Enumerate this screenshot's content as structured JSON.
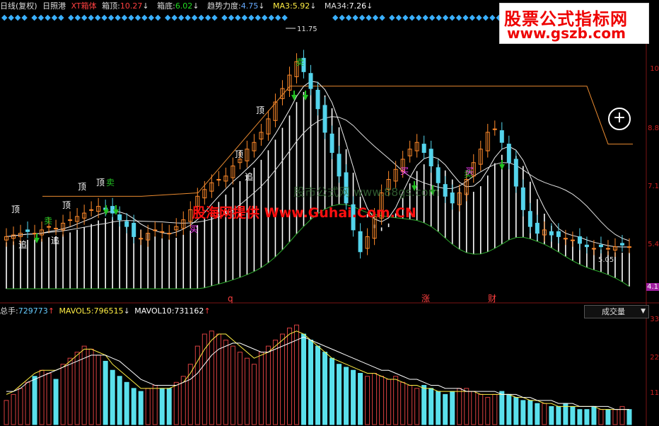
{
  "header": {
    "period": "日线(复权)",
    "stock": "日照港",
    "indicator": "XT箱体",
    "box_top_label": "箱顶:",
    "box_top_value": "10.27",
    "box_top_arrow": "↓",
    "box_bottom_label": "箱底:",
    "box_bottom_value": "6.02",
    "box_bottom_arrow": "↓",
    "trend_label": "趋势力度:",
    "trend_value": "4.75",
    "trend_arrow": "↓",
    "ma3_label": "MA3:",
    "ma3_value": "5.92",
    "ma3_arrow": "↓",
    "ma34_label": "MA34:",
    "ma34_value": "7.26",
    "ma34_arrow": "↓"
  },
  "volume_header": {
    "total_label": "总手:",
    "total_value": "729773",
    "total_arrow": "↑",
    "mavol5_label": "MAVOL5:",
    "mavol5_value": "796515",
    "mavol5_arrow": "↓",
    "mavol10_label": "MAVOL10:",
    "mavol10_value": "731162",
    "mavol10_arrow": "↑"
  },
  "selector": {
    "value": "成交量",
    "arrow": "▼"
  },
  "watermark": {
    "title": "股票公式指标网",
    "url": "www.gszb.com"
  },
  "center_watermark": "股海网提供 Www.Guhai.Com.CN",
  "faint_watermark": "股市公式网  www.88gs.com",
  "plus_icon": "+",
  "colors": {
    "up": "#ff8a2a",
    "down": "#54d4ec",
    "sell_signal": "#22c022",
    "buy_signal": "#ff40ff",
    "box_line": "#e98a30",
    "ma_line": "#e0e0e0",
    "axis_text": "#d02020",
    "vol_up": "#d84040",
    "vol_down": "#5ae0ec"
  },
  "chart_data": [
    {
      "type": "candlestick",
      "price_axis_labels": [
        "10",
        "8.8",
        "7.1",
        "5.4",
        "4.1"
      ],
      "high_marker": "11.75",
      "low_marker": "5.05",
      "annotations": {
        "top_labels": [
          "顶",
          "顶",
          "顶",
          "顶",
          "顶",
          "顶"
        ],
        "sell_labels": [
          "卖",
          "卖",
          "卖",
          "卖"
        ],
        "buy_labels": [
          "买",
          "买",
          "买"
        ],
        "chase_labels": [
          "追",
          "追",
          "追"
        ],
        "event_labels": [
          "q",
          "涨",
          "财"
        ]
      },
      "box_line_values": [
        7.0,
        7.0,
        7.1,
        10.27,
        10.27,
        8.55,
        8.55
      ],
      "closes": [
        5.8,
        5.85,
        5.9,
        5.95,
        5.9,
        6.0,
        6.1,
        6.05,
        6.2,
        6.3,
        6.4,
        6.5,
        6.6,
        6.7,
        6.6,
        6.5,
        6.3,
        6.1,
        5.8,
        5.75,
        5.9,
        6.0,
        5.95,
        5.9,
        6.1,
        6.3,
        6.6,
        7.0,
        7.2,
        7.4,
        7.5,
        7.6,
        7.9,
        8.1,
        8.4,
        8.6,
        8.9,
        9.3,
        9.8,
        10.2,
        10.6,
        11.0,
        10.7,
        10.2,
        9.6,
        8.9,
        8.3,
        7.6,
        6.8,
        6.0,
        5.35,
        5.8,
        6.4,
        7.1,
        7.5,
        7.8,
        8.1,
        8.4,
        8.6,
        8.3,
        7.9,
        7.4,
        7.0,
        6.8,
        7.1,
        7.5,
        8.0,
        8.4,
        8.9,
        9.0,
        8.6,
        8.0,
        7.3,
        6.6,
        6.1,
        5.9,
        6.0,
        5.85,
        5.8,
        5.75,
        5.7,
        5.6,
        5.5,
        5.45,
        5.5,
        5.45,
        5.5,
        5.55,
        5.5
      ]
    },
    {
      "type": "bar",
      "name_label": "成交量",
      "y_axis_labels": [
        "33",
        "22",
        "11"
      ],
      "values": [
        8,
        10,
        12,
        14,
        16,
        18,
        17,
        15,
        20,
        22,
        24,
        26,
        25,
        23,
        21,
        18,
        16,
        14,
        12,
        11,
        12,
        13,
        12,
        12,
        14,
        16,
        20,
        26,
        30,
        31,
        30,
        28,
        26,
        24,
        22,
        20,
        24,
        26,
        28,
        30,
        32,
        33,
        30,
        28,
        26,
        24,
        22,
        20,
        19,
        18,
        17,
        16,
        17,
        16,
        15,
        16,
        14,
        13,
        12,
        13,
        12,
        11,
        10,
        11,
        12,
        12,
        11,
        10,
        9,
        10,
        11,
        10,
        9,
        8,
        8,
        7,
        7,
        6,
        6,
        7,
        6,
        5,
        5,
        6,
        5,
        5,
        5,
        6,
        5
      ],
      "mavol5": [
        10,
        11,
        13,
        15,
        17,
        18,
        18,
        18,
        19,
        21,
        23,
        25,
        25,
        24,
        23,
        20,
        18,
        16,
        14,
        12,
        12,
        12,
        12,
        12,
        13,
        14,
        17,
        21,
        25,
        28,
        30,
        30,
        28,
        26,
        24,
        22,
        23,
        24,
        26,
        28,
        30,
        31,
        30,
        28,
        26,
        24,
        22,
        21,
        20,
        19,
        18,
        17,
        17,
        16,
        15,
        15,
        14,
        13,
        13,
        12,
        12,
        11,
        11,
        11,
        11,
        11,
        11,
        10,
        10,
        10,
        10,
        10,
        9,
        9,
        8,
        8,
        7,
        7,
        6,
        6,
        6,
        6,
        6,
        6,
        5,
        5,
        5,
        5,
        5
      ],
      "mavol10": [
        11,
        11,
        12,
        14,
        15,
        16,
        17,
        18,
        19,
        20,
        21,
        22,
        23,
        23,
        23,
        22,
        21,
        19,
        17,
        15,
        14,
        13,
        13,
        13,
        13,
        14,
        15,
        17,
        20,
        23,
        25,
        26,
        27,
        27,
        26,
        25,
        24,
        24,
        25,
        26,
        27,
        28,
        29,
        28,
        27,
        26,
        25,
        24,
        23,
        22,
        21,
        20,
        19,
        18,
        18,
        17,
        16,
        15,
        15,
        14,
        13,
        13,
        12,
        12,
        12,
        11,
        11,
        11,
        11,
        11,
        10,
        10,
        10,
        9,
        9,
        8,
        8,
        8,
        7,
        7,
        7,
        6,
        6,
        6,
        6,
        6,
        5,
        5,
        5
      ]
    }
  ]
}
